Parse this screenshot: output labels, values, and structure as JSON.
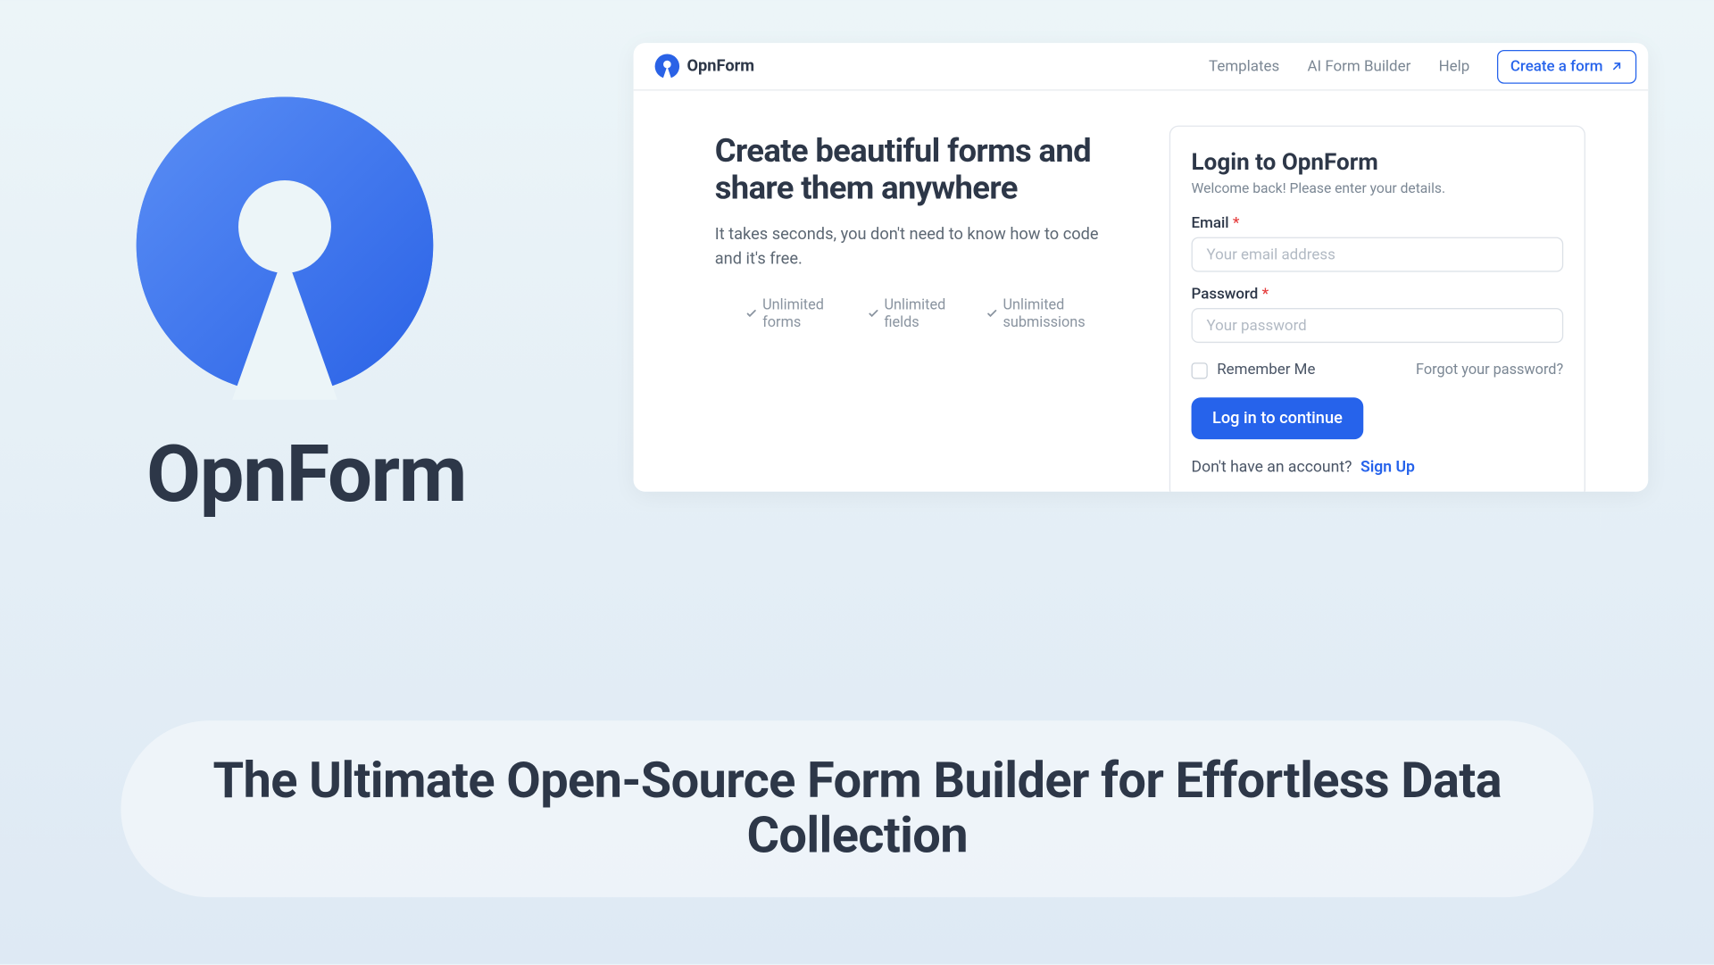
{
  "brand": {
    "name": "OpnForm"
  },
  "app": {
    "title": "OpnForm",
    "nav": {
      "templates": "Templates",
      "ai": "AI Form Builder",
      "help": "Help",
      "create": "Create a form"
    },
    "pitch": {
      "title": "Create beautiful forms and share them anywhere",
      "subtitle": "It takes seconds, you don't need to know how to code and it's free.",
      "features": {
        "f1": "Unlimited forms",
        "f2": "Unlimited fields",
        "f3": "Unlimited submissions"
      }
    },
    "login": {
      "title": "Login to OpnForm",
      "subtitle": "Welcome back! Please enter your details.",
      "email_label": "Email",
      "email_placeholder": "Your email address",
      "password_label": "Password",
      "password_placeholder": "Your password",
      "remember": "Remember Me",
      "forgot": "Forgot your password?",
      "submit": "Log in to continue",
      "signup_prompt": "Don't have an account?",
      "signup_link": "Sign Up"
    }
  },
  "tagline": "The Ultimate Open-Source Form Builder for Effortless Data Collection",
  "colors": {
    "primary": "#2663eb",
    "text": "#2d3748",
    "muted": "#7b8794"
  }
}
